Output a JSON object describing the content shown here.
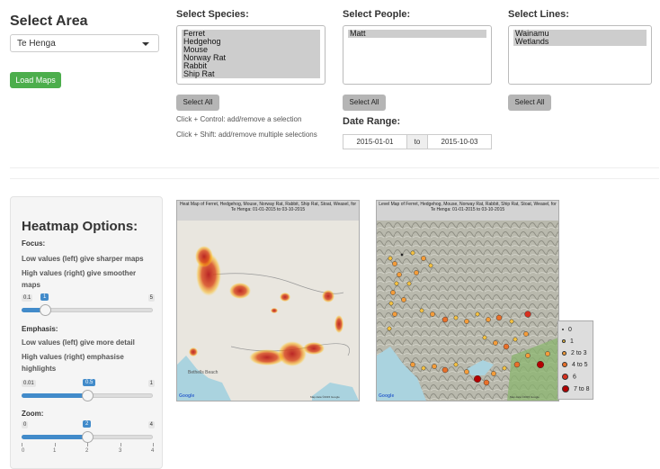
{
  "area": {
    "title": "Select Area",
    "selected": "Te Henga",
    "load_button": "Load Maps"
  },
  "species": {
    "title": "Select Species",
    "options": [
      "Ferret",
      "Hedgehog",
      "Mouse",
      "Norway Rat",
      "Rabbit",
      "Ship Rat"
    ],
    "select_all": "Select All",
    "help1": "Click + Control: add/remove a selection",
    "help2": "Click + Shift: add/remove multiple selections"
  },
  "people": {
    "title": "Select People",
    "options": [
      "Matt"
    ],
    "select_all": "Select All"
  },
  "lines": {
    "title": "Select Lines",
    "options": [
      "Wainamu",
      "Wetlands"
    ],
    "select_all": "Select All"
  },
  "date_range": {
    "title": "Date Range:",
    "start": "2015-01-01",
    "to": "to",
    "end": "2015-10-03"
  },
  "heatmap_options": {
    "title": "Heatmap Options:",
    "focus_label": "Focus:",
    "focus_desc1": "Low values (left) give sharper maps",
    "focus_desc2": "High values (right) give smoother maps",
    "focus_slider": {
      "min": "0.1",
      "max": "5",
      "value": "1",
      "fraction": 0.18
    },
    "emphasis_label": "Emphasis:",
    "emphasis_desc1": "Low values (left) give more detail",
    "emphasis_desc2": "High values (right) emphasise highlights",
    "emphasis_slider": {
      "min": "0.01",
      "max": "1",
      "value": "0.5",
      "fraction": 0.5
    },
    "zoom_label": "Zoom:",
    "zoom_slider": {
      "min": "0",
      "max": "4",
      "value": "2",
      "fraction": 0.5,
      "ticks": [
        "0",
        "1",
        "2",
        "3",
        "4"
      ]
    }
  },
  "heat_map": {
    "header": "Heat Map of Ferret, Hedgehog, Mouse, Norway Rat, Rabbit, Ship Rat, Stoat, Weasel, for Te Henga: 01-01-2015 to 03-10-2015",
    "place_label": "Bethells Beach",
    "google_label": "Google",
    "credit": "Map data ©2015 Google"
  },
  "level_map": {
    "header": "Level Map of Ferret, Hedgehog, Mouse, Norway Rat, Rabbit, Ship Rat, Stoat, Weasel, for Te Henga: 01-01-2015 to 03-10-2015",
    "google_label": "Google",
    "credit": "Map data ©2015 Google"
  },
  "legend": {
    "items": [
      {
        "label": "0",
        "color": "#222222"
      },
      {
        "label": "1",
        "color": "#f5c242"
      },
      {
        "label": "2 to 3",
        "color": "#f39c3a"
      },
      {
        "label": "4 to 5",
        "color": "#e8702a"
      },
      {
        "label": "6",
        "color": "#d7301f"
      },
      {
        "label": "7 to 8",
        "color": "#b30000"
      }
    ]
  },
  "colors": {
    "accent": "#428bca",
    "load_button": "#4cae4c",
    "heat": "#c62828"
  }
}
